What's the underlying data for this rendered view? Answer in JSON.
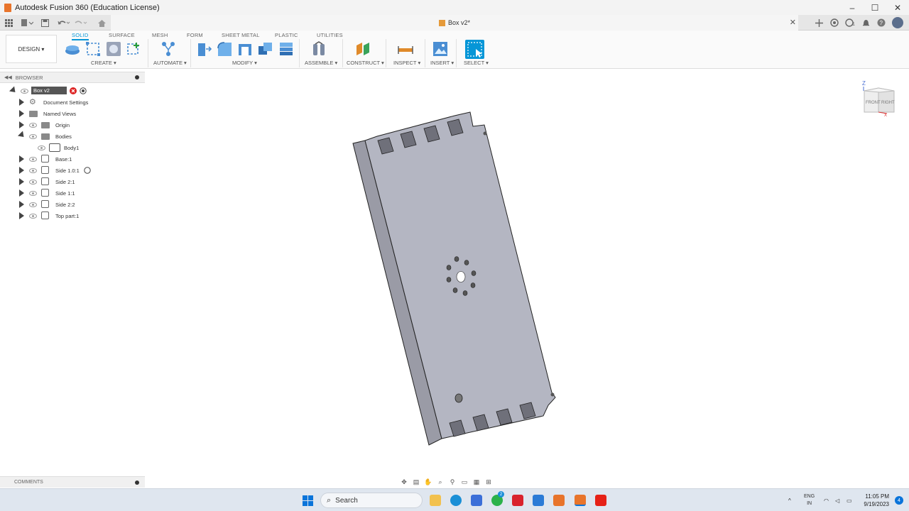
{
  "window": {
    "title": "Autodesk Fusion 360 (Education License)",
    "controls": [
      "–",
      "☐",
      "✕"
    ]
  },
  "document_tab": {
    "name": "Box v2*",
    "close": "✕"
  },
  "workspace": {
    "label": "DESIGN ▾"
  },
  "ribbon_tabs": [
    "SOLID",
    "SURFACE",
    "MESH",
    "FORM",
    "SHEET METAL",
    "PLASTIC",
    "UTILITIES"
  ],
  "ribbon_groups": {
    "create": "CREATE ▾",
    "automate": "AUTOMATE ▾",
    "modify": "MODIFY ▾",
    "assemble": "ASSEMBLE ▾",
    "construct": "CONSTRUCT ▾",
    "inspect": "INSPECT ▾",
    "insert": "INSERT ▾",
    "select": "SELECT ▾"
  },
  "browser": {
    "title": "BROWSER",
    "root": "Box v2",
    "items": [
      "Document Settings",
      "Named Views",
      "Origin",
      "Bodies",
      "Body1",
      "Base:1",
      "Side 1.0:1",
      "Side 2:1",
      "Side 1:1",
      "Side 2:2",
      "Top part:1"
    ]
  },
  "viewcube": {
    "top": "Z",
    "front": "FRONT",
    "right": "RIGHT",
    "x": "X"
  },
  "comments": {
    "label": "COMMENTS"
  },
  "taskbar": {
    "search": "Search",
    "lang_top": "ENG",
    "lang_bottom": "IN",
    "time": "11:05 PM",
    "date": "9/19/2023",
    "notifications": "4",
    "whatsapp_badge": "2",
    "up_arrow": "^"
  },
  "colors": {
    "accent": "#0696d7",
    "part_face": "#b4b6c2",
    "part_side": "#9a9ba6"
  }
}
